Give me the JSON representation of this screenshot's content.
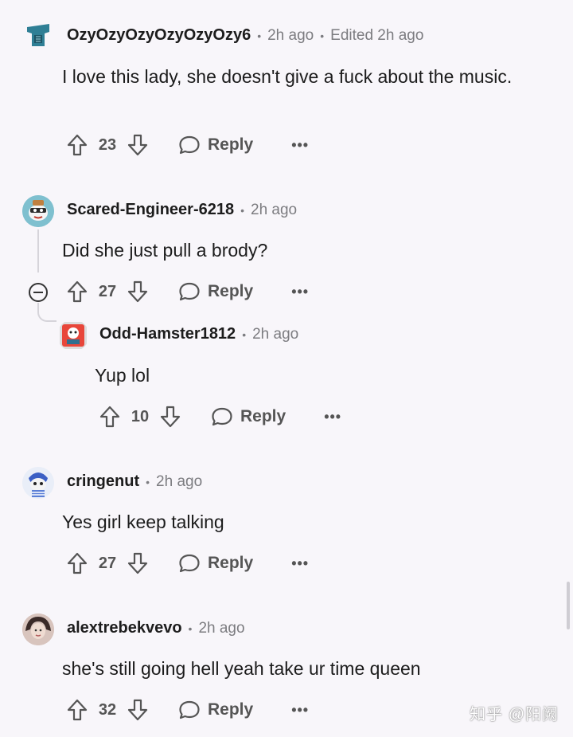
{
  "comments": [
    {
      "username": "OzyOzyOzyOzyOzyOzy6",
      "time": "2h ago",
      "edited": "Edited 2h ago",
      "text": "I love this lady, she doesn't give a fuck about the music.",
      "score": "23",
      "reply_label": "Reply",
      "more_label": "•••",
      "avatar_color": "#2f7f95"
    },
    {
      "username": "Scared-Engineer-6218",
      "time": "2h ago",
      "text": "Did she just pull a brody?",
      "score": "27",
      "reply_label": "Reply",
      "more_label": "•••",
      "avatar_color": "#6fa8b8"
    },
    {
      "username": "Odd-Hamster1812",
      "time": "2h ago",
      "text": "Yup lol",
      "score": "10",
      "reply_label": "Reply",
      "more_label": "•••",
      "avatar_color": "#e8463a"
    },
    {
      "username": "cringenut",
      "time": "2h ago",
      "text": "Yes girl keep talking",
      "score": "27",
      "reply_label": "Reply",
      "more_label": "•••",
      "avatar_color": "#5b7fd6"
    },
    {
      "username": "alextrebekvevo",
      "time": "2h ago",
      "text": "she's still going hell yeah take ur time queen",
      "score": "32",
      "reply_label": "Reply",
      "more_label": "•••",
      "avatar_color": "#c9a8a0"
    }
  ],
  "watermark": "知乎 @阳阙",
  "icons": {
    "upvote": "arrow-up-icon",
    "downvote": "arrow-down-icon",
    "reply": "speech-bubble-icon",
    "collapse": "minus-circle-icon"
  }
}
